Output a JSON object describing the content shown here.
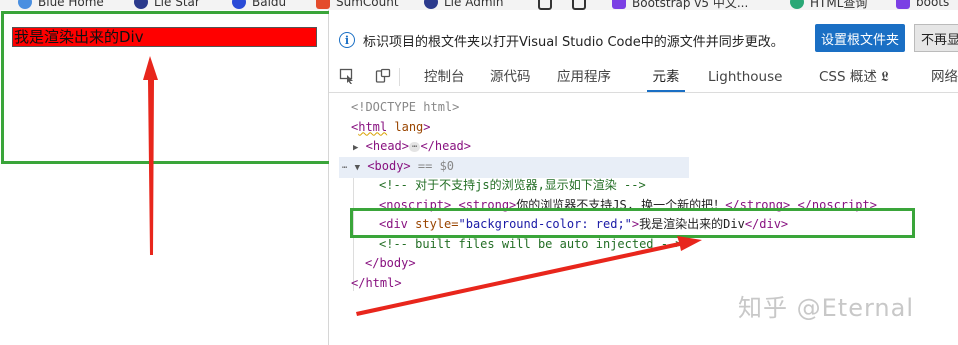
{
  "bookmarks": [
    {
      "label": "Blue Home",
      "color": "#4a8fe0"
    },
    {
      "label": "Lie Star",
      "color": "#2b3a8c"
    },
    {
      "label": "Baidu",
      "color": "#2a4bd7"
    },
    {
      "label": "SumCount",
      "color": "#e44c2c"
    },
    {
      "label": "Lie Admin",
      "color": "#2b3a8c"
    },
    {
      "label": "",
      "color": "#333333"
    },
    {
      "label": "",
      "color": "#333333"
    },
    {
      "label": "Bootstrap v5 中文...",
      "color": "#7b3fe4"
    },
    {
      "label": "HTML查询",
      "color": "#2aa876"
    },
    {
      "label": "boots",
      "color": "#7b3fe4"
    }
  ],
  "page": {
    "div_text": "我是渲染出来的Div",
    "div_color": "#ff0000"
  },
  "devtools": {
    "info_icon": "info-icon",
    "info_text": "标识项目的根文件夹以打开Visual Studio Code中的源文件并同步更改。",
    "set_root_button": "设置根文件夹",
    "dont_show_button": "不再显",
    "tabs": [
      {
        "label": "控制台",
        "active": false
      },
      {
        "label": "源代码",
        "active": false
      },
      {
        "label": "应用程序",
        "active": false
      },
      {
        "label": "元素",
        "active": true
      },
      {
        "label": "Lighthouse",
        "active": false
      },
      {
        "label": "CSS 概述 𝕷",
        "active": false
      },
      {
        "label": "网络",
        "active": false
      }
    ],
    "dom": {
      "doctype": "<!DOCTYPE html>",
      "html_open_tag": "html",
      "html_attr": "lang",
      "head_line_open": "<head>",
      "head_ellipsis": "⋯",
      "head_line_close": "</head>",
      "body_tag": "<body>",
      "body_marker": "== $0",
      "comment1": "<!-- 对于不支持js的浏览器,显示如下渲染  -->",
      "noscript_open": "<noscript>",
      "strong_open": "<strong>",
      "noscript_text": "你的浏览器不支持JS, 换一个新的把！",
      "strong_close": "</strong>",
      "noscript_close": "</noscript>",
      "div_open": "<div",
      "div_attr": "style=",
      "div_attr_val": "\"background-color: red;\"",
      "div_gt": ">",
      "div_text": "我是渲染出来的Div",
      "div_close": "</div>",
      "comment2": "<!-- built files will be auto injected -->",
      "body_close": "</body>",
      "html_close": "</html>"
    },
    "highlight_color": "#3aa53a"
  },
  "watermark": "知乎 @Eternal",
  "arrow_color": "#e8261c"
}
